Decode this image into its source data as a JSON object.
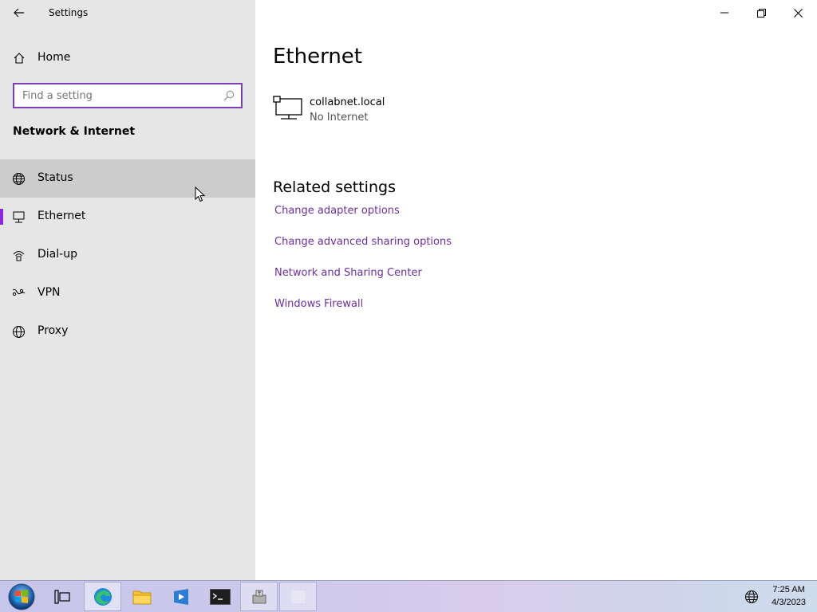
{
  "window": {
    "title": "Settings",
    "controls": [
      "minimize",
      "restore",
      "close"
    ]
  },
  "sidebar": {
    "home_label": "Home",
    "search_placeholder": "Find a setting",
    "section_title": "Network & Internet",
    "items": [
      {
        "label": "Status",
        "icon": "status-globe-icon",
        "state": "hover"
      },
      {
        "label": "Ethernet",
        "icon": "ethernet-icon",
        "state": "selected"
      },
      {
        "label": "Dial-up",
        "icon": "dialup-icon",
        "state": "normal"
      },
      {
        "label": "VPN",
        "icon": "vpn-icon",
        "state": "normal"
      },
      {
        "label": "Proxy",
        "icon": "globe-icon",
        "state": "normal"
      }
    ]
  },
  "main": {
    "title": "Ethernet",
    "network": {
      "name": "collabnet.local",
      "status": "No Internet"
    },
    "related_title": "Related settings",
    "links": [
      "Change adapter options",
      "Change advanced sharing options",
      "Network and Sharing Center",
      "Windows Firewall"
    ]
  },
  "taskbar": {
    "apps": [
      "start-orb",
      "task-view",
      "edge",
      "file-explorer",
      "media-app",
      "terminal",
      "installer",
      "blank-window"
    ],
    "clock_time": "7:25 AM",
    "clock_date": "4/3/2023"
  },
  "colors": {
    "accent": "#8a2be2",
    "link": "#6b2fa3",
    "sidebar_bg": "#e6e6e6",
    "hover_bg": "#cccccc"
  }
}
